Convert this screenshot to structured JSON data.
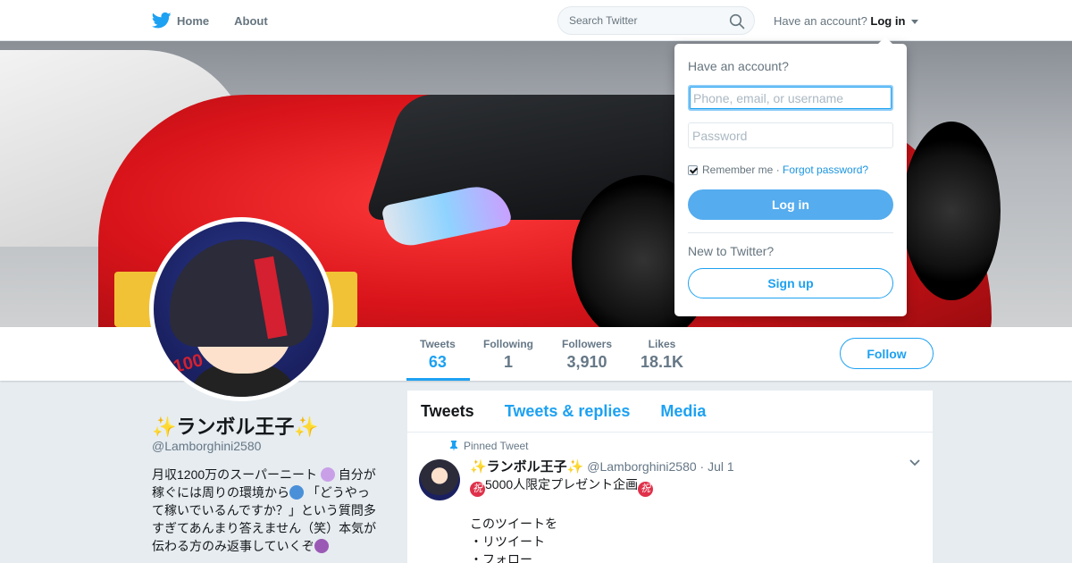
{
  "nav": {
    "home": "Home",
    "about": "About",
    "search_placeholder": "Search Twitter",
    "have_account": "Have an account?",
    "login": "Log in"
  },
  "stats": [
    {
      "label": "Tweets",
      "value": "63"
    },
    {
      "label": "Following",
      "value": "1"
    },
    {
      "label": "Followers",
      "value": "3,910"
    },
    {
      "label": "Likes",
      "value": "18.1K"
    }
  ],
  "follow_label": "Follow",
  "profile": {
    "name": "✨ランボル王子✨",
    "handle": "@Lamborghini2580",
    "bio_lines": [
      "月収1200万のスーパーニート",
      "自分が",
      "稼ぐには周りの環境から",
      "「どうやっ",
      "て稼いでいるんですか？」という質問多",
      "すぎてあんまり答えません（笑）本気が",
      "伝わる方のみ返事していくぞ"
    ]
  },
  "banner_image_text": "100",
  "tabs": [
    "Tweets",
    "Tweets & replies",
    "Media"
  ],
  "tweet": {
    "pinned": "Pinned Tweet",
    "name": "✨ランボル王子✨",
    "handle": "@Lamborghini2580",
    "date": "· Jul 1",
    "line1": "5000人限定プレゼント企画",
    "line_blank": "",
    "line2": "このツイートを",
    "line3": "・リツイート",
    "line4": "・フォロー",
    "iwai": "祝"
  },
  "login_dropdown": {
    "title": "Have an account?",
    "username_placeholder": "Phone, email, or username",
    "password_placeholder": "Password",
    "remember": "Remember me",
    "separator": " · ",
    "forgot": "Forgot password?",
    "login_button": "Log in",
    "new_label": "New to Twitter?",
    "signup_button": "Sign up"
  },
  "colors": {
    "accent": "#1da1f2",
    "login_button": "#55acee",
    "background": "#e6ecf0"
  }
}
